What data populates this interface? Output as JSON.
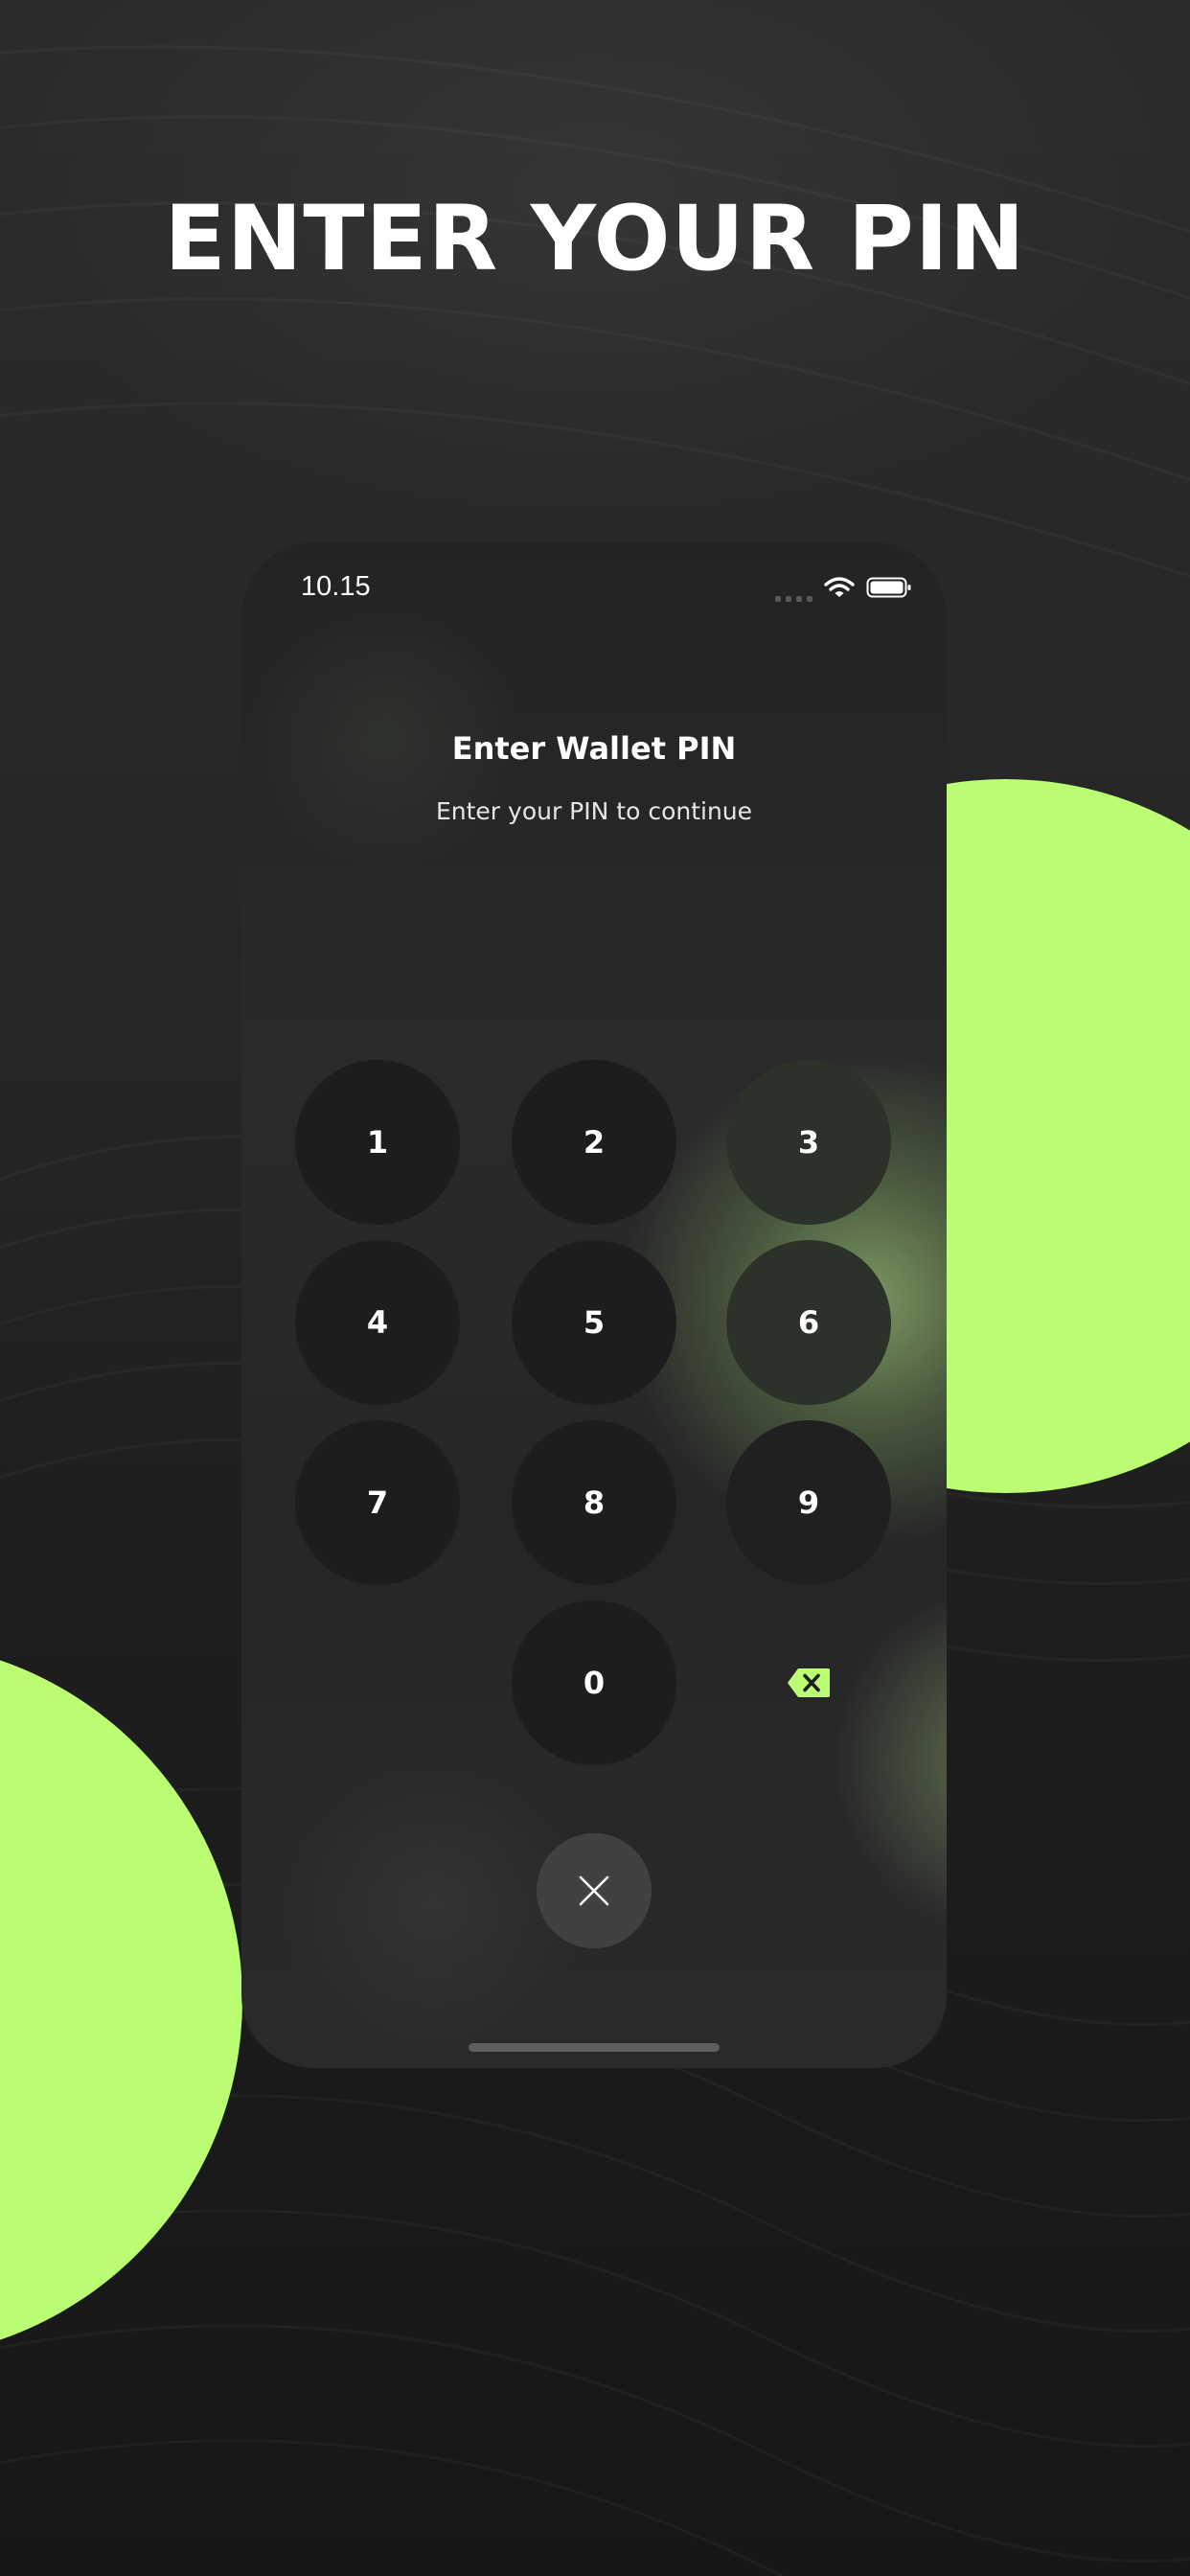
{
  "headline": "ENTER YOUR PIN",
  "status_bar": {
    "time": "10.15",
    "icons": [
      "signal-icon",
      "wifi-icon",
      "battery-icon"
    ]
  },
  "screen": {
    "title": "Enter Wallet PIN",
    "subtitle": "Enter your PIN to continue"
  },
  "keypad": {
    "keys": [
      "1",
      "2",
      "3",
      "4",
      "5",
      "6",
      "7",
      "8",
      "9",
      "0"
    ],
    "delete_icon": "backspace-icon",
    "close_icon": "close-icon"
  },
  "colors": {
    "accent": "#bbfd73",
    "background": "#1c1c1d",
    "phone_surface": "#262627",
    "key_fill": "#1d1d1e",
    "close_button": "#414143",
    "text": "#ffffff"
  }
}
